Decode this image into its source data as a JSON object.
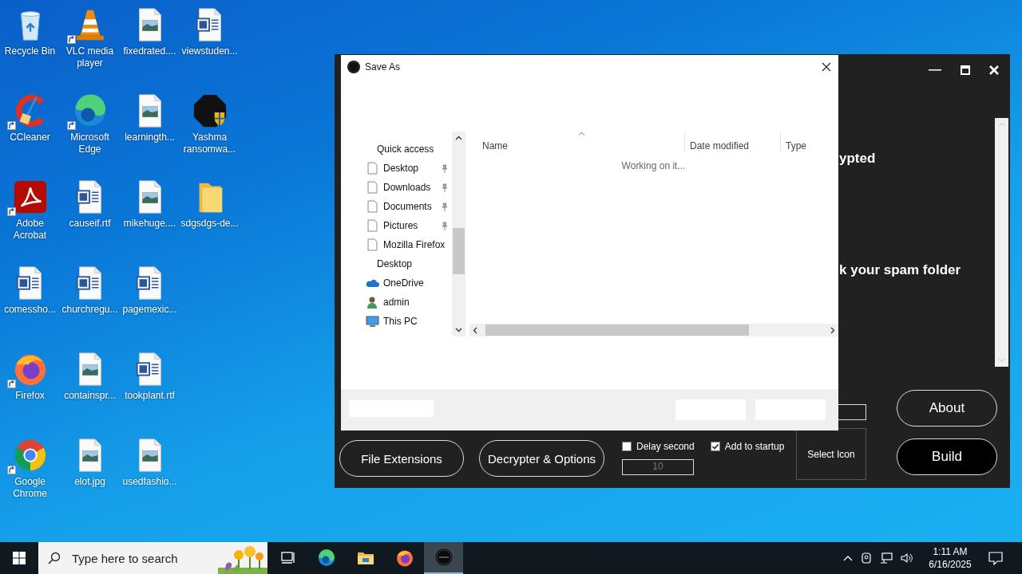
{
  "desktop": {
    "icons": [
      {
        "label": "Recycle Bin",
        "kind": "recycle",
        "shortcut": false
      },
      {
        "label": "CCleaner",
        "kind": "ccleaner",
        "shortcut": true
      },
      {
        "label": "Adobe Acrobat",
        "kind": "acrobat",
        "shortcut": true
      },
      {
        "label": "comessho...",
        "kind": "word",
        "shortcut": false
      },
      {
        "label": "Firefox",
        "kind": "firefox",
        "shortcut": true
      },
      {
        "label": "Google Chrome",
        "kind": "chrome",
        "shortcut": true
      },
      {
        "label": "VLC media player",
        "kind": "vlc",
        "shortcut": true
      },
      {
        "label": "Microsoft Edge",
        "kind": "edge",
        "shortcut": true
      },
      {
        "label": "causeif.rtf",
        "kind": "word",
        "shortcut": false
      },
      {
        "label": "churchregu...",
        "kind": "word",
        "shortcut": false
      },
      {
        "label": "containspr...",
        "kind": "image",
        "shortcut": false
      },
      {
        "label": "elot.jpg",
        "kind": "image",
        "shortcut": false
      },
      {
        "label": "fixedrated....",
        "kind": "image",
        "shortcut": false
      },
      {
        "label": "learningth...",
        "kind": "image",
        "shortcut": false
      },
      {
        "label": "mikehuge....",
        "kind": "image",
        "shortcut": false
      },
      {
        "label": "pagemexic...",
        "kind": "word",
        "shortcut": false
      },
      {
        "label": "tookplant.rtf",
        "kind": "word",
        "shortcut": false
      },
      {
        "label": "usedfashio...",
        "kind": "image",
        "shortcut": false
      },
      {
        "label": "viewstuden...",
        "kind": "word",
        "shortcut": false
      },
      {
        "label": "Yashma ransomwa...",
        "kind": "yashma",
        "shortcut": false
      },
      {
        "label": "sdgsdgs-de...",
        "kind": "folder",
        "shortcut": false
      }
    ]
  },
  "app_window": {
    "text_lines": [
      "ypted",
      "k your spam folder"
    ],
    "buttons": [
      {
        "label": "File Extensions",
        "kind": "outline"
      },
      {
        "label": "Decrypter & Options",
        "kind": "outline"
      },
      {
        "label": "About",
        "kind": "outline"
      },
      {
        "label": "Build",
        "kind": "filled"
      }
    ],
    "checkboxes": [
      {
        "label": "Delay second",
        "checked": false
      },
      {
        "label": "Add to startup",
        "checked": true
      }
    ],
    "delay_field": {
      "value": "10",
      "disabled": true
    },
    "select_icon": "Select Icon"
  },
  "save_dialog": {
    "title": "Save As",
    "navigation": [
      {
        "label": "Quick access",
        "kind": "header",
        "pinned": false
      },
      {
        "label": "Desktop",
        "kind": "file",
        "pinned": true
      },
      {
        "label": "Downloads",
        "kind": "file",
        "pinned": true
      },
      {
        "label": "Documents",
        "kind": "file",
        "pinned": true
      },
      {
        "label": "Pictures",
        "kind": "file",
        "pinned": true
      },
      {
        "label": "Mozilla Firefox",
        "kind": "file",
        "pinned": false
      },
      {
        "label": "Desktop",
        "kind": "header",
        "pinned": false
      },
      {
        "label": "OneDrive",
        "kind": "cloud",
        "pinned": false
      },
      {
        "label": "admin",
        "kind": "user",
        "pinned": false
      },
      {
        "label": "This PC",
        "kind": "pc",
        "pinned": false
      }
    ],
    "columns": [
      "Name",
      "Date modified",
      "Type"
    ],
    "status": "Working on it..."
  },
  "taskbar": {
    "search_placeholder": "Type here to search",
    "apps": [
      {
        "kind": "taskview",
        "selected": false
      },
      {
        "kind": "edge",
        "selected": false
      },
      {
        "kind": "explorer",
        "selected": false
      },
      {
        "kind": "firefox",
        "selected": false
      },
      {
        "kind": "chaos",
        "selected": true
      }
    ],
    "time": "1:11 AM",
    "date": "6/16/2025"
  }
}
